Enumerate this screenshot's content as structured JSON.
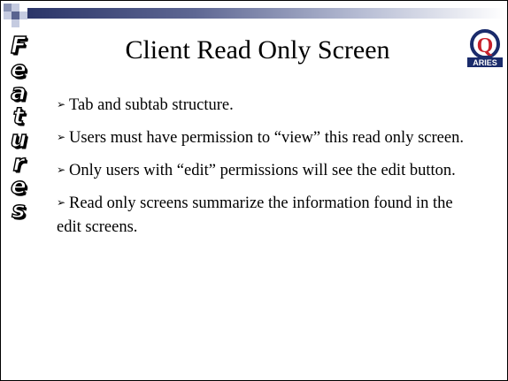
{
  "slide": {
    "title": "Client Read Only Screen",
    "sidebar_word": [
      "F",
      "e",
      "a",
      "t",
      "u",
      "r",
      "e",
      "s"
    ],
    "logo": {
      "letter": "Q",
      "text": "ARIES",
      "colors": {
        "ring": "#1a2b6b",
        "q": "#c8202a",
        "banner": "#1a2b6b"
      }
    },
    "bullets": [
      {
        "marker": "➢",
        "text": "Tab and subtab structure."
      },
      {
        "marker": "➢",
        "text": "Users must have permission to “view” this read only screen."
      },
      {
        "marker": "➢",
        "text": "Only users with “edit” permissions will see the edit button."
      },
      {
        "marker": "➢",
        "text": "Read only screens summarize the information found in the edit screens."
      }
    ]
  },
  "colors": {
    "topbar_dark": "#2b3568",
    "topbar_light": "#ffffff",
    "text": "#000000"
  }
}
